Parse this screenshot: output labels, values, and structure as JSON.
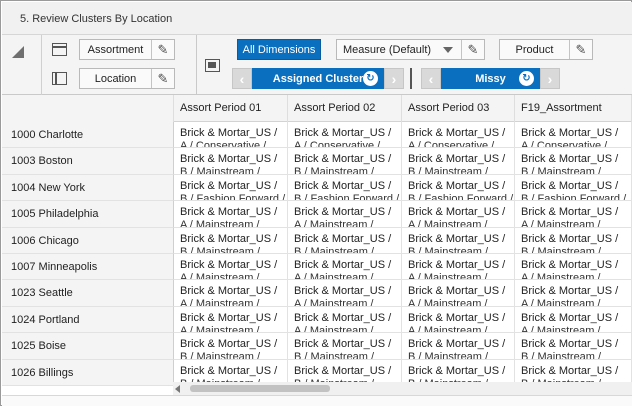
{
  "window": {
    "title": "5. Review Clusters By Location"
  },
  "row_dims": {
    "assortment": "Assortment",
    "location": "Location"
  },
  "col_dims": {
    "all_dimensions": "All Dimensions",
    "measure": "Measure (Default)",
    "product": "Product"
  },
  "slices": {
    "first": "Assigned Cluster",
    "second": "Missy"
  },
  "icons": {
    "edit": "pencil-icon",
    "prev": "chevron-left-icon",
    "next": "chevron-right-icon",
    "reset": "reset-icon",
    "pivot": "pivot-corner-icon"
  },
  "grid": {
    "columns": [
      "Assort Period 01",
      "Assort Period 02",
      "Assort Period 03",
      "F19_Assortment"
    ],
    "rows": [
      {
        "label": "1000 Charlotte",
        "cells": [
          "Brick & Mortar_US /",
          "Brick & Mortar_US /",
          "Brick & Mortar_US /",
          "Brick & Mortar_US /"
        ],
        "line2": [
          "A / Conservative /",
          "A / Conservative /",
          "A / Conservative /",
          "A / Conservative /"
        ]
      },
      {
        "label": "1003 Boston",
        "cells": [
          "Brick & Mortar_US /",
          "Brick & Mortar_US /",
          "Brick & Mortar_US /",
          "Brick & Mortar_US /"
        ],
        "line2": [
          "B / Mainstream /",
          "B / Mainstream /",
          "B / Mainstream /",
          "B / Mainstream /"
        ]
      },
      {
        "label": "1004 New York",
        "cells": [
          "Brick & Mortar_US /",
          "Brick & Mortar_US /",
          "Brick & Mortar_US /",
          "Brick & Mortar_US /"
        ],
        "line2": [
          "B / Fashion Forward /",
          "B / Fashion Forward /",
          "B / Fashion Forward /",
          "B / Fashion Forward /"
        ]
      },
      {
        "label": "1005 Philadelphia",
        "cells": [
          "Brick & Mortar_US /",
          "Brick & Mortar_US /",
          "Brick & Mortar_US /",
          "Brick & Mortar_US /"
        ],
        "line2": [
          "A / Mainstream /",
          "A / Mainstream /",
          "A / Mainstream /",
          "A / Mainstream /"
        ]
      },
      {
        "label": "1006 Chicago",
        "cells": [
          "Brick & Mortar_US /",
          "Brick & Mortar_US /",
          "Brick & Mortar_US /",
          "Brick & Mortar_US /"
        ],
        "line2": [
          "B / Mainstream /",
          "B / Mainstream /",
          "B / Mainstream /",
          "B / Mainstream /"
        ]
      },
      {
        "label": "1007 Minneapolis",
        "cells": [
          "Brick & Mortar_US /",
          "Brick & Mortar_US /",
          "Brick & Mortar_US /",
          "Brick & Mortar_US /"
        ],
        "line2": [
          "A / Mainstream /",
          "A / Mainstream /",
          "A / Mainstream /",
          "A / Mainstream /"
        ]
      },
      {
        "label": "1023 Seattle",
        "cells": [
          "Brick & Mortar_US /",
          "Brick & Mortar_US /",
          "Brick & Mortar_US /",
          "Brick & Mortar_US /"
        ],
        "line2": [
          "A / Mainstream /",
          "A / Mainstream /",
          "A / Mainstream /",
          "A / Mainstream /"
        ]
      },
      {
        "label": "1024 Portland",
        "cells": [
          "Brick & Mortar_US /",
          "Brick & Mortar_US /",
          "Brick & Mortar_US /",
          "Brick & Mortar_US /"
        ],
        "line2": [
          "A / Mainstream /",
          "A / Mainstream /",
          "A / Mainstream /",
          "A / Mainstream /"
        ]
      },
      {
        "label": "1025 Boise",
        "cells": [
          "Brick & Mortar_US /",
          "Brick & Mortar_US /",
          "Brick & Mortar_US /",
          "Brick & Mortar_US /"
        ],
        "line2": [
          "B / Mainstream /",
          "B / Mainstream /",
          "B / Mainstream /",
          "B / Mainstream /"
        ]
      },
      {
        "label": "1026 Billings",
        "cells": [
          "Brick & Mortar_US /",
          "Brick & Mortar_US /",
          "Brick & Mortar_US /",
          "Brick & Mortar_US /"
        ],
        "line2": [
          "B / Mainstream /",
          "B / Mainstream /",
          "B / Mainstream /",
          "B / Mainstream /"
        ]
      }
    ]
  },
  "colors": {
    "accent": "#0a6fbf",
    "header_bg": "#f4f4f4"
  }
}
